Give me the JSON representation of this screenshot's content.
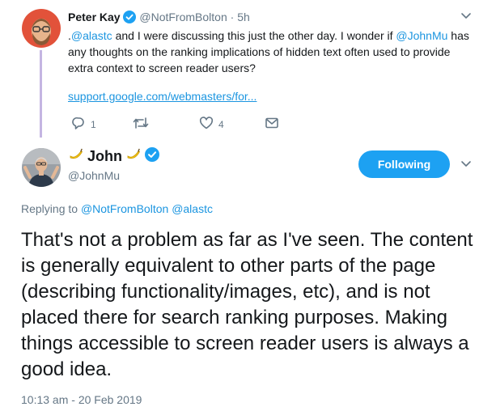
{
  "parent_tweet": {
    "name": "Peter Kay",
    "handle": "@NotFromBolton",
    "separator": "·",
    "time": "5h",
    "text_parts": {
      "dot": ".",
      "mention1": "@alastc",
      "mid": " and I were discussing this just the other day. I wonder if ",
      "mention2": "@JohnMu",
      "end": " has any thoughts on the ranking implications of hidden text often used to provide extra context to screen reader users?"
    },
    "link": "support.google.com/webmasters/for...",
    "actions": {
      "reply_count": "1",
      "retweet_count": "",
      "like_count": "4"
    }
  },
  "main_tweet": {
    "name": "John",
    "handle": "@JohnMu",
    "follow_label": "Following",
    "replying_prefix": "Replying to ",
    "replying_mention1": "@NotFromBolton",
    "replying_mention2": "@alastc",
    "text": "That's not a problem as far as I've seen. The content is generally equivalent to other parts of the page (describing functionality/images, etc), and is not placed there for search ranking purposes. Making things accessible to screen reader users is always a good idea.",
    "timestamp": "10:13 am - 20 Feb 2019"
  },
  "icons": [
    "reply-icon",
    "retweet-icon",
    "like-icon",
    "dm-icon",
    "verified-icon",
    "banana-icon",
    "chevron-down-icon"
  ],
  "colors": {
    "link": "#1b95e0",
    "follow_button": "#1da1f2",
    "verified": "#1da1f2",
    "thread_line": "#c4b5e2",
    "meta_text": "#657786"
  }
}
